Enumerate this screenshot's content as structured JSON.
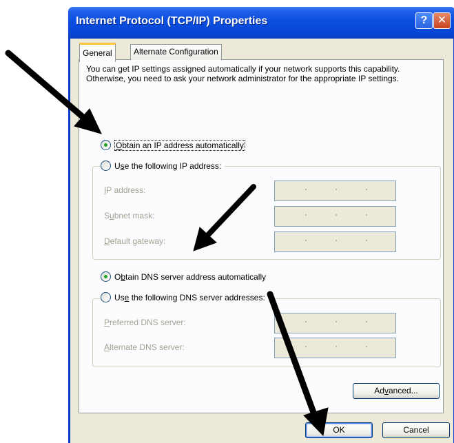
{
  "window": {
    "title": "Internet Protocol (TCP/IP) Properties",
    "help_icon": "?",
    "close_icon": "✕"
  },
  "tabs": [
    {
      "label": "General",
      "selected": true
    },
    {
      "label": "Alternate Configuration",
      "selected": false
    }
  ],
  "description": "You can get IP settings assigned automatically if your network supports this capability. Otherwise, you need to ask your network administrator for the appropriate IP settings.",
  "ip_settings": {
    "auto_option": {
      "pre": "",
      "ul": "O",
      "post": "btain an IP address automatically",
      "selected": true
    },
    "manual_option": {
      "pre": "U",
      "ul": "s",
      "post": "e the following IP address:",
      "selected": false
    },
    "fields": [
      {
        "pre": "",
        "ul": "I",
        "post": "P address:",
        "value": ""
      },
      {
        "pre": "S",
        "ul": "u",
        "post": "bnet mask:",
        "value": ""
      },
      {
        "pre": "",
        "ul": "D",
        "post": "efault gateway:",
        "value": ""
      }
    ]
  },
  "dns_settings": {
    "auto_option": {
      "pre": "O",
      "ul": "b",
      "post": "tain DNS server address automatically",
      "selected": true
    },
    "manual_option": {
      "pre": "Us",
      "ul": "e",
      "post": " the following DNS server addresses:",
      "selected": false
    },
    "fields": [
      {
        "pre": "",
        "ul": "P",
        "post": "referred DNS server:",
        "value": ""
      },
      {
        "pre": "",
        "ul": "A",
        "post": "lternate DNS server:",
        "value": ""
      }
    ]
  },
  "buttons": {
    "advanced": {
      "pre": "Ad",
      "ul": "v",
      "post": "anced..."
    },
    "ok": "OK",
    "cancel": "Cancel"
  },
  "colors": {
    "title_bar": "#0b4fe0",
    "dialog_bg": "#ece9d8",
    "arrow": "#000000"
  },
  "icons": {
    "help": "help-icon",
    "close": "close-icon",
    "annotation_arrows": "arrow-icon"
  }
}
